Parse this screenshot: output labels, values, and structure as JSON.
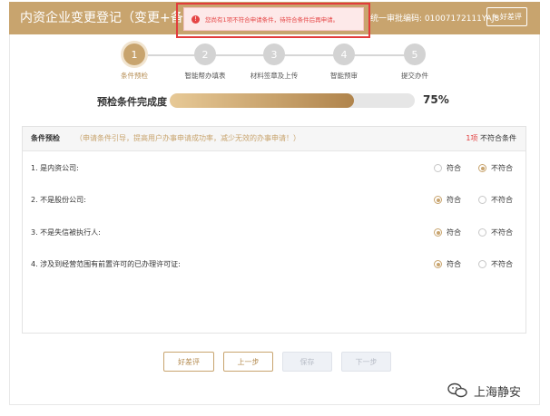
{
  "header": {
    "title": "内资企业变更登记（变更+备案）",
    "code_text": "统一审批编码: 01007172111YAJ8",
    "feedback_label": "好差评"
  },
  "alert": {
    "text": "您尚有1项不符合申请条件，待符合条件后再申请。"
  },
  "steps": [
    {
      "num": "1",
      "label": "条件预检"
    },
    {
      "num": "2",
      "label": "智能帮办填表"
    },
    {
      "num": "3",
      "label": "材料签章及上传"
    },
    {
      "num": "4",
      "label": "智能预审"
    },
    {
      "num": "5",
      "label": "提交办件"
    }
  ],
  "progress": {
    "label": "预检条件完成度",
    "percent_text": "75%",
    "value": 0.75
  },
  "panel": {
    "title": "条件预检",
    "hint": "（申请条件引导，提高用户办事申请成功率，减少无效的办事申请！）",
    "count_num": "1项",
    "count_text": "不符合条件",
    "yes_label": "符合",
    "no_label": "不符合",
    "conditions": [
      {
        "text": "1. 是内资公司:",
        "selected": "no"
      },
      {
        "text": "2. 不是股份公司:",
        "selected": "yes"
      },
      {
        "text": "3. 不是失信被执行人:",
        "selected": "yes"
      },
      {
        "text": "4. 涉及到经营范围有前置许可的已办理许可证:",
        "selected": "yes"
      }
    ]
  },
  "buttons": {
    "feedback": "好差评",
    "prev": "上一步",
    "save": "保存",
    "next": "下一步"
  },
  "watermark": {
    "text": "上海静安"
  },
  "colors": {
    "accent": "#c8a46e",
    "error": "#e23c3c"
  }
}
